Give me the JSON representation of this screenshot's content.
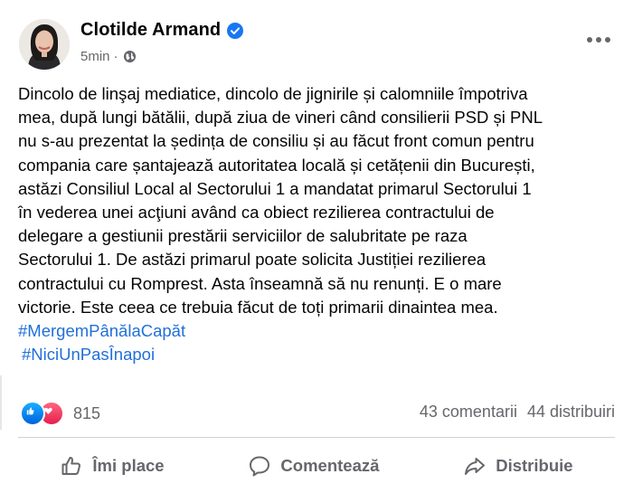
{
  "author": {
    "name": "Clotilde Armand",
    "time": "5min",
    "verified": true,
    "privacy_icon": "globe-icon"
  },
  "post": {
    "lines": [
      "Dincolo de linşaj mediatice, dincolo de jignirile și calomniile împotriva",
      "mea, după lungi bătălii, după ziua de vineri când consilierii PSD și PNL",
      "nu s-au prezentat la ședința de consiliu și au făcut front comun pentru",
      "compania care șantajează autoritatea locală și cetățenii din București,",
      "astăzi Consiliul Local al Sectorului 1 a mandatat primarul Sectorului 1",
      "în vederea unei acţiuni având ca obiect rezilierea contractului de",
      "delegare a gestiunii prestării serviciilor de salubritate pe raza",
      "Sectorului 1. De astăzi primarul poate solicita Justiției rezilierea",
      "contractului cu Romprest. Asta înseamnă să nu renunți. E o mare",
      "victorie. Este ceea ce trebuia făcut de toți primarii dinaintea mea."
    ],
    "hashtags": [
      "#MergemPânălaCapăt",
      "#NiciUnPasÎnapoi"
    ]
  },
  "reactions": {
    "count": "815",
    "types": [
      "like-icon",
      "love-icon"
    ],
    "comments": "43 comentarii",
    "shares": "44 distribuiri"
  },
  "actions": {
    "like": "Îmi place",
    "comment": "Comentează",
    "share": "Distribuie"
  },
  "colors": {
    "hashtag": "#216fdb",
    "verified": "#1877f2",
    "secondary_text": "#65676b"
  }
}
